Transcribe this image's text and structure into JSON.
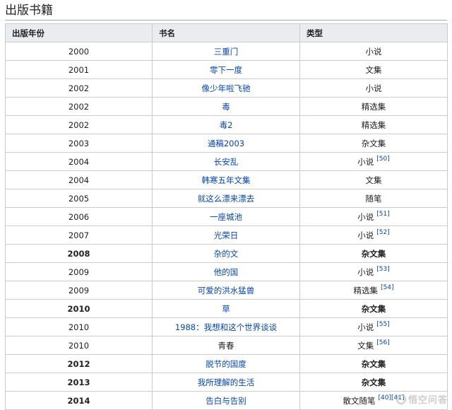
{
  "section": {
    "title": "出版书籍"
  },
  "table": {
    "headers": [
      "出版年份",
      "书名",
      "类型"
    ],
    "rows": [
      {
        "year": "2000",
        "title": "三重门",
        "type": "小说",
        "ref": ""
      },
      {
        "year": "2001",
        "title": "零下一度",
        "type": "文集",
        "ref": ""
      },
      {
        "year": "2002",
        "title": "像少年啦飞驰",
        "type": "小说",
        "ref": ""
      },
      {
        "year": "2002",
        "title": "毒",
        "type": "精选集",
        "ref": ""
      },
      {
        "year": "2002",
        "title": "毒2",
        "type": "精选集",
        "ref": ""
      },
      {
        "year": "2003",
        "title": "通稿2003",
        "type": "杂文集",
        "ref": ""
      },
      {
        "year": "2004",
        "title": "长安乱",
        "type": "小说",
        "ref": "[50]"
      },
      {
        "year": "2004",
        "title": "韩寒五年文集",
        "type": "文集",
        "ref": ""
      },
      {
        "year": "2005",
        "title": "就这么漂来漂去",
        "type": "随笔",
        "ref": ""
      },
      {
        "year": "2006",
        "title": "一座城池",
        "type": "小说",
        "ref": "[51]"
      },
      {
        "year": "2007",
        "title": "光荣日",
        "type": "小说",
        "ref": "[52]"
      },
      {
        "year": "2008",
        "title": "杂的文",
        "type": "杂文集",
        "ref": ""
      },
      {
        "year": "2009",
        "title": "他的国",
        "type": "小说",
        "ref": "[53]"
      },
      {
        "year": "2009",
        "title": "可爱的洪水猛兽",
        "type": "精选集",
        "ref": "[54]"
      },
      {
        "year": "2010",
        "title": "草",
        "type": "杂文集",
        "ref": ""
      },
      {
        "year": "2010",
        "title": "1988：我想和这个世界谈谈",
        "type": "小说",
        "ref": "[55]"
      },
      {
        "year": "2010",
        "title": "青春",
        "type": "文集",
        "ref": "[56]"
      },
      {
        "year": "2012",
        "title": "脱节的国度",
        "type": "杂文集",
        "ref": ""
      },
      {
        "year": "2013",
        "title": "我所理解的生活",
        "type": "杂文集",
        "ref": ""
      },
      {
        "year": "2014",
        "title": "告白与告别",
        "type": "散文随笔",
        "ref": "[40][41]"
      }
    ]
  },
  "watermark": {
    "text": "悟空问答"
  }
}
